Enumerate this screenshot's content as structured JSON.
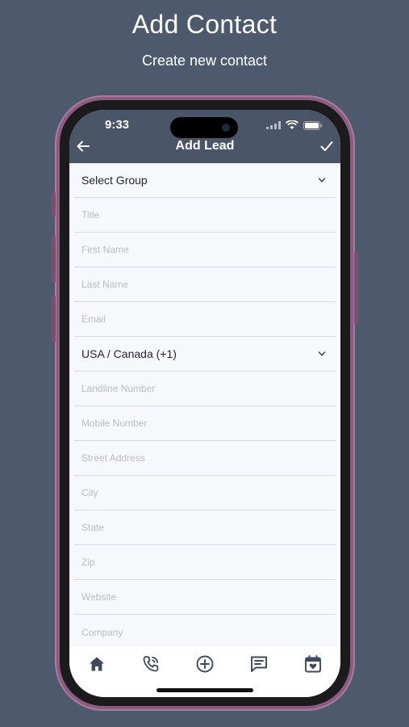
{
  "promo": {
    "headline": "Add Contact",
    "subhead": "Create new contact"
  },
  "status_bar": {
    "time": "9:33"
  },
  "nav": {
    "title": "Add Lead",
    "back_icon": "arrow-left-icon",
    "confirm_icon": "check-icon"
  },
  "form": {
    "group_select": "Select Group",
    "title_placeholder": "Title",
    "first_name_placeholder": "First Name",
    "last_name_placeholder": "Last Name",
    "email_placeholder": "Email",
    "country_select": "USA / Canada (+1)",
    "landline_placeholder": "Landline Number",
    "mobile_placeholder": "Mobile Number",
    "street_placeholder": "Street Address",
    "city_placeholder": "City",
    "state_placeholder": "State",
    "zip_placeholder": "Zip",
    "website_placeholder": "Website",
    "company_placeholder": "Company"
  },
  "tabbar": {
    "items": [
      "home-icon",
      "phone-call-icon",
      "add-circle-icon",
      "message-icon",
      "calendar-heart-icon"
    ]
  },
  "colors": {
    "background": "#4d5a6e",
    "appbar": "#4a5568",
    "phone_frame": "#8a5d7e",
    "icon": "#3d4a5c"
  }
}
